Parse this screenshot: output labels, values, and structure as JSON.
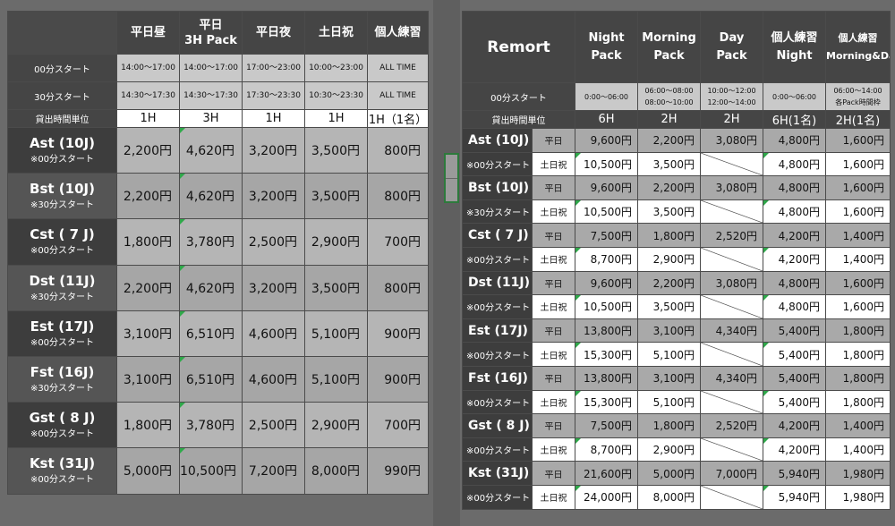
{
  "left": {
    "headers": [
      "平日昼",
      "平日\n3H Pack",
      "平日夜",
      "土日祝",
      "個人練習"
    ],
    "rows_meta": [
      {
        "label": "00分スタート",
        "values": [
          "14:00〜17:00",
          "14:00〜17:00",
          "17:00〜23:00",
          "10:00〜23:00",
          "ALL TIME"
        ]
      },
      {
        "label": "30分スタート",
        "values": [
          "14:30〜17:30",
          "14:30〜17:30",
          "17:30〜23:30",
          "10:30〜23:30",
          "ALL TIME"
        ]
      },
      {
        "label": "貸出時間単位",
        "values": [
          "1H",
          "3H",
          "1H",
          "1H",
          "1H（1名）"
        ]
      }
    ],
    "studios": [
      {
        "name": "Ast (10J)",
        "start": "※00分スタート",
        "prices": [
          "2,200円",
          "4,620円",
          "3,200円",
          "3,500円",
          "800円"
        ]
      },
      {
        "name": "Bst (10J)",
        "start": "※30分スタート",
        "prices": [
          "2,200円",
          "4,620円",
          "3,200円",
          "3,500円",
          "800円"
        ]
      },
      {
        "name": "Cst ( 7 J)",
        "start": "※00分スタート",
        "prices": [
          "1,800円",
          "3,780円",
          "2,500円",
          "2,900円",
          "700円"
        ]
      },
      {
        "name": "Dst (11J)",
        "start": "※30分スタート",
        "prices": [
          "2,200円",
          "4,620円",
          "3,200円",
          "3,500円",
          "800円"
        ]
      },
      {
        "name": "Est (17J)",
        "start": "※00分スタート",
        "prices": [
          "3,100円",
          "6,510円",
          "4,600円",
          "5,100円",
          "900円"
        ]
      },
      {
        "name": "Fst (16J)",
        "start": "※30分スタート",
        "prices": [
          "3,100円",
          "6,510円",
          "4,600円",
          "5,100円",
          "900円"
        ]
      },
      {
        "name": "Gst ( 8 J)",
        "start": "※00分スタート",
        "prices": [
          "1,800円",
          "3,780円",
          "2,500円",
          "2,900円",
          "700円"
        ]
      },
      {
        "name": "Kst (31J)",
        "start": "※00分スタート",
        "prices": [
          "5,000円",
          "10,500円",
          "7,200円",
          "8,000円",
          "990円"
        ]
      }
    ]
  },
  "right": {
    "title": "Remort",
    "headers": [
      "Night\nPack",
      "Morning\nPack",
      "Day\nPack",
      "個人練習\nNight",
      "個人練習\nMorning&Day"
    ],
    "start_row": {
      "label": "00分スタート",
      "values": [
        "0:00〜06:00",
        "06:00〜08:00\n08:00〜10:00",
        "10:00〜12:00\n12:00〜14:00",
        "0:00〜06:00",
        "06:00〜14:00\n各Pack時間枠"
      ]
    },
    "unit_row": {
      "label": "貸出時間単位",
      "values": [
        "6H",
        "2H",
        "2H",
        "6H(1名)",
        "2H(1名)"
      ]
    },
    "day_types": [
      "平日",
      "土日祝"
    ],
    "studios": [
      {
        "name": "Ast (10J)",
        "start": "※00分スタート",
        "weekday": [
          "9,600円",
          "2,200円",
          "3,080円",
          "4,800円",
          "1,600円"
        ],
        "holiday": [
          "10,500円",
          "3,500円",
          "",
          "4,800円",
          "1,600円"
        ]
      },
      {
        "name": "Bst (10J)",
        "start": "※30分スタート",
        "weekday": [
          "9,600円",
          "2,200円",
          "3,080円",
          "4,800円",
          "1,600円"
        ],
        "holiday": [
          "10,500円",
          "3,500円",
          "",
          "4,800円",
          "1,600円"
        ]
      },
      {
        "name": "Cst ( 7 J)",
        "start": "※00分スタート",
        "weekday": [
          "7,500円",
          "1,800円",
          "2,520円",
          "4,200円",
          "1,400円"
        ],
        "holiday": [
          "8,700円",
          "2,900円",
          "",
          "4,200円",
          "1,400円"
        ]
      },
      {
        "name": "Dst (11J)",
        "start": "※00分スタート",
        "weekday": [
          "9,600円",
          "2,200円",
          "3,080円",
          "4,800円",
          "1,600円"
        ],
        "holiday": [
          "10,500円",
          "3,500円",
          "",
          "4,800円",
          "1,600円"
        ]
      },
      {
        "name": "Est (17J)",
        "start": "※00分スタート",
        "weekday": [
          "13,800円",
          "3,100円",
          "4,340円",
          "5,400円",
          "1,800円"
        ],
        "holiday": [
          "15,300円",
          "5,100円",
          "",
          "5,400円",
          "1,800円"
        ]
      },
      {
        "name": "Fst (16J)",
        "start": "※00分スタート",
        "weekday": [
          "13,800円",
          "3,100円",
          "4,340円",
          "5,400円",
          "1,800円"
        ],
        "holiday": [
          "15,300円",
          "5,100円",
          "",
          "5,400円",
          "1,800円"
        ]
      },
      {
        "name": "Gst ( 8 J)",
        "start": "※00分スタート",
        "weekday": [
          "7,500円",
          "1,800円",
          "2,520円",
          "4,200円",
          "1,400円"
        ],
        "holiday": [
          "8,700円",
          "2,900円",
          "",
          "4,200円",
          "1,400円"
        ]
      },
      {
        "name": "Kst (31J)",
        "start": "※00分スタート",
        "weekday": [
          "21,600円",
          "5,000円",
          "7,000円",
          "5,940円",
          "1,980円"
        ],
        "holiday": [
          "24,000円",
          "8,000円",
          "",
          "5,940円",
          "1,980円"
        ]
      }
    ]
  }
}
